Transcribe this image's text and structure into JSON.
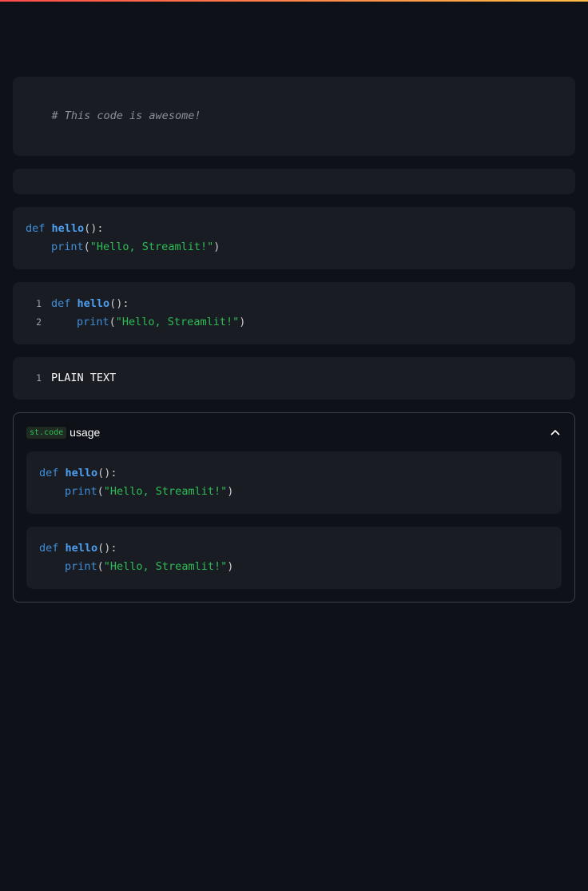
{
  "blocks": {
    "comment": "# This code is awesome!",
    "hello_plain": {
      "kw": "def",
      "fn": "hello",
      "sig": "():",
      "builtin": "print",
      "open": "(",
      "str": "\"Hello, Streamlit!\"",
      "close": ")"
    },
    "hello_numbered": {
      "ln1": "1",
      "ln2": "2",
      "kw": "def",
      "fn": "hello",
      "sig": "():",
      "builtin": "print",
      "open": "(",
      "str": "\"Hello, Streamlit!\"",
      "close": ")"
    },
    "plain_text": {
      "ln1": "1",
      "text": "PLAIN TEXT"
    }
  },
  "expander": {
    "code_label": "st.code",
    "label": "usage",
    "expanded": true,
    "chevron_icon": "chevron-up-icon",
    "code": {
      "kw": "def",
      "fn": "hello",
      "sig": "():",
      "builtin": "print",
      "open": "(",
      "str": "\"Hello, Streamlit!\"",
      "close": ")"
    }
  },
  "colors": {
    "background": "#0e1117",
    "code_background": "#1a1c24",
    "keyword": "#3f8ed8",
    "string": "#2dbd54",
    "comment": "#8b8f99"
  }
}
